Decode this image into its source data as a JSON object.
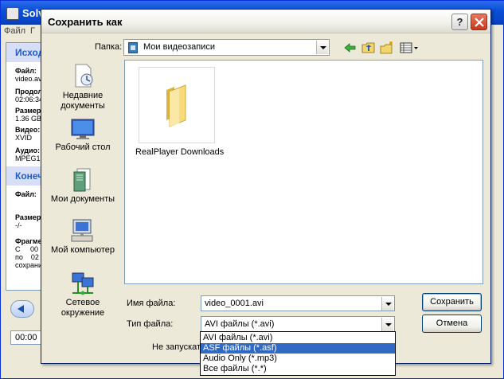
{
  "background_app": {
    "title": "Solv",
    "menu": [
      "Файл",
      "Г"
    ],
    "source_header": "Исход",
    "dest_header": "Конеч",
    "fields": [
      {
        "label": "Файл:",
        "value": "video.av"
      },
      {
        "label": "Продол",
        "value": "02:06:34"
      },
      {
        "label": "Размер",
        "value": "1.36 GB"
      },
      {
        "label": "Видео:",
        "value": "XVID"
      },
      {
        "label": "Аудио:",
        "value": "MPEG1"
      }
    ],
    "dest_fields": [
      {
        "label": "Файл:",
        "value": ""
      },
      {
        "label": "Размер",
        "value": "-/-"
      },
      {
        "label": "Фрагме",
        "value": "С     00\nпо    02\nсохрани"
      }
    ],
    "time_value": "00:00"
  },
  "dialog": {
    "title": "Сохранить как",
    "help_label": "?",
    "folder_label": "Папка:",
    "folder_value": "Мои видеозаписи",
    "places": [
      {
        "label": "Недавние документы",
        "icon": "recent-documents-icon"
      },
      {
        "label": "Рабочий стол",
        "icon": "desktop-icon"
      },
      {
        "label": "Мои документы",
        "icon": "my-documents-icon"
      },
      {
        "label": "Мой компьютер",
        "icon": "my-computer-icon"
      },
      {
        "label": "Сетевое окружение",
        "icon": "network-icon"
      }
    ],
    "files": [
      {
        "name": "RealPlayer Downloads",
        "icon": "folder-icon"
      }
    ],
    "filename_label": "Имя файла:",
    "filename_value": "video_0001.avi",
    "filetype_label": "Тип файла:",
    "filetype_value": "AVI файлы (*.avi)",
    "save_label": "Сохранить",
    "cancel_label": "Отмена",
    "no_start_text": "Не запускат",
    "filetype_options": [
      {
        "label": "AVI файлы (*.avi)",
        "selected": false
      },
      {
        "label": "ASF файлы (*.asf)",
        "selected": true
      },
      {
        "label": "Audio Only (*.mp3)",
        "selected": false
      },
      {
        "label": "Все файлы (*.*)",
        "selected": false
      }
    ]
  }
}
